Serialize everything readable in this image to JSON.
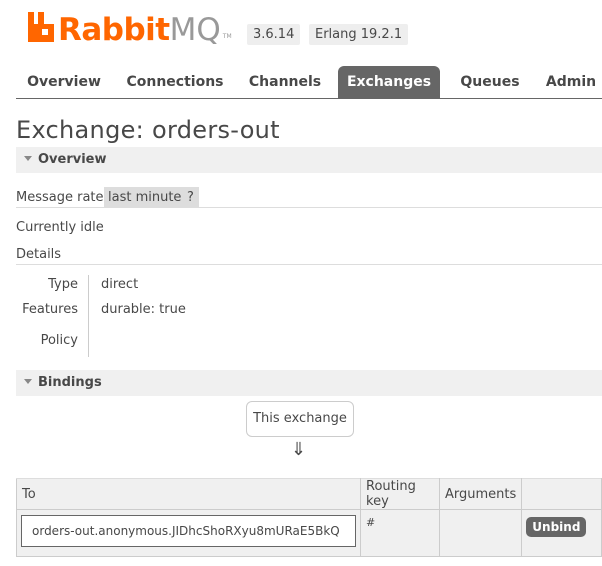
{
  "header": {
    "logo_primary": "Rabbit",
    "logo_secondary": "MQ",
    "logo_tm": "TM",
    "version": "3.6.14",
    "erlang": "Erlang 19.2.1"
  },
  "tabs": [
    {
      "label": "Overview"
    },
    {
      "label": "Connections"
    },
    {
      "label": "Channels"
    },
    {
      "label": "Exchanges",
      "active": true
    },
    {
      "label": "Queues"
    },
    {
      "label": "Admin"
    }
  ],
  "page": {
    "title": "Exchange: orders-out"
  },
  "overview": {
    "heading": "Overview",
    "message_rates_label": "Message rates",
    "message_rates_value": "last minute",
    "help": "?",
    "status": "Currently idle",
    "details_label": "Details",
    "type_key": "Type",
    "type_value": "direct",
    "features_key": "Features",
    "features_value": "durable: true",
    "policy_key": "Policy",
    "policy_value": ""
  },
  "bindings": {
    "heading": "Bindings",
    "source_box": "This exchange",
    "arrow": "⇓",
    "columns": [
      "To",
      "Routing key",
      "Arguments",
      ""
    ],
    "rows": [
      {
        "to": "orders-out.anonymous.JIDhcShoRXyu8mURaE5BkQ",
        "routing_key": "#",
        "arguments": "",
        "action": "Unbind"
      }
    ]
  },
  "colors": {
    "brand_orange": "#ff6600",
    "tab_active": "#666666",
    "section_bg": "#f0f0f0"
  }
}
